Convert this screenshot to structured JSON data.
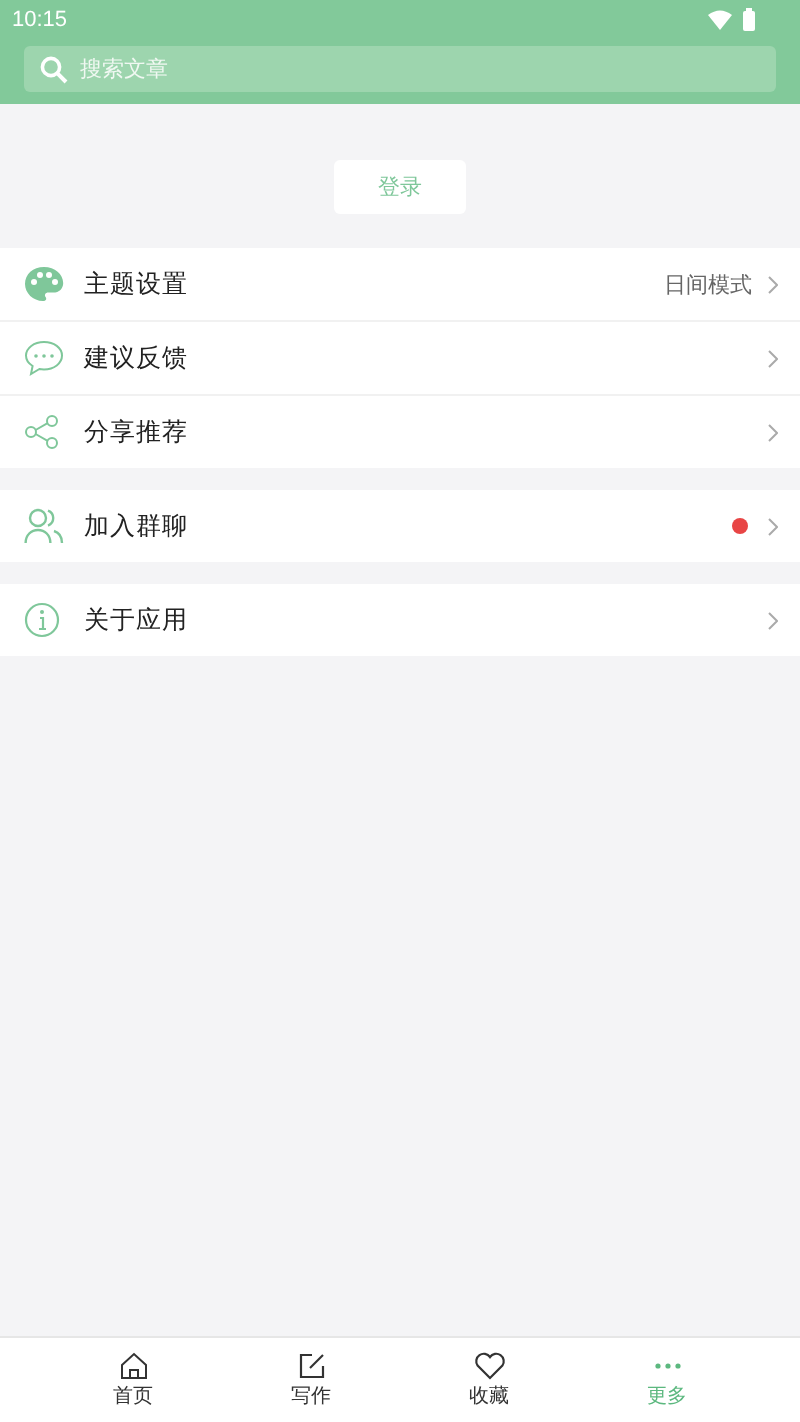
{
  "status_bar": {
    "time": "10:15"
  },
  "search": {
    "placeholder": "搜索文章"
  },
  "login_button": "登录",
  "menu_groups": [
    {
      "items": [
        {
          "label": "主题设置",
          "value": "日间模式",
          "dot": false
        },
        {
          "label": "建议反馈",
          "dot": false
        },
        {
          "label": "分享推荐",
          "dot": false
        }
      ]
    },
    {
      "items": [
        {
          "label": "加入群聊",
          "dot": true
        }
      ]
    },
    {
      "items": [
        {
          "label": "关于应用",
          "dot": false
        }
      ]
    }
  ],
  "tabs": [
    {
      "label": "首页",
      "selected": false
    },
    {
      "label": "写作",
      "selected": false
    },
    {
      "label": "收藏",
      "selected": false
    },
    {
      "label": "更多",
      "selected": true
    }
  ]
}
